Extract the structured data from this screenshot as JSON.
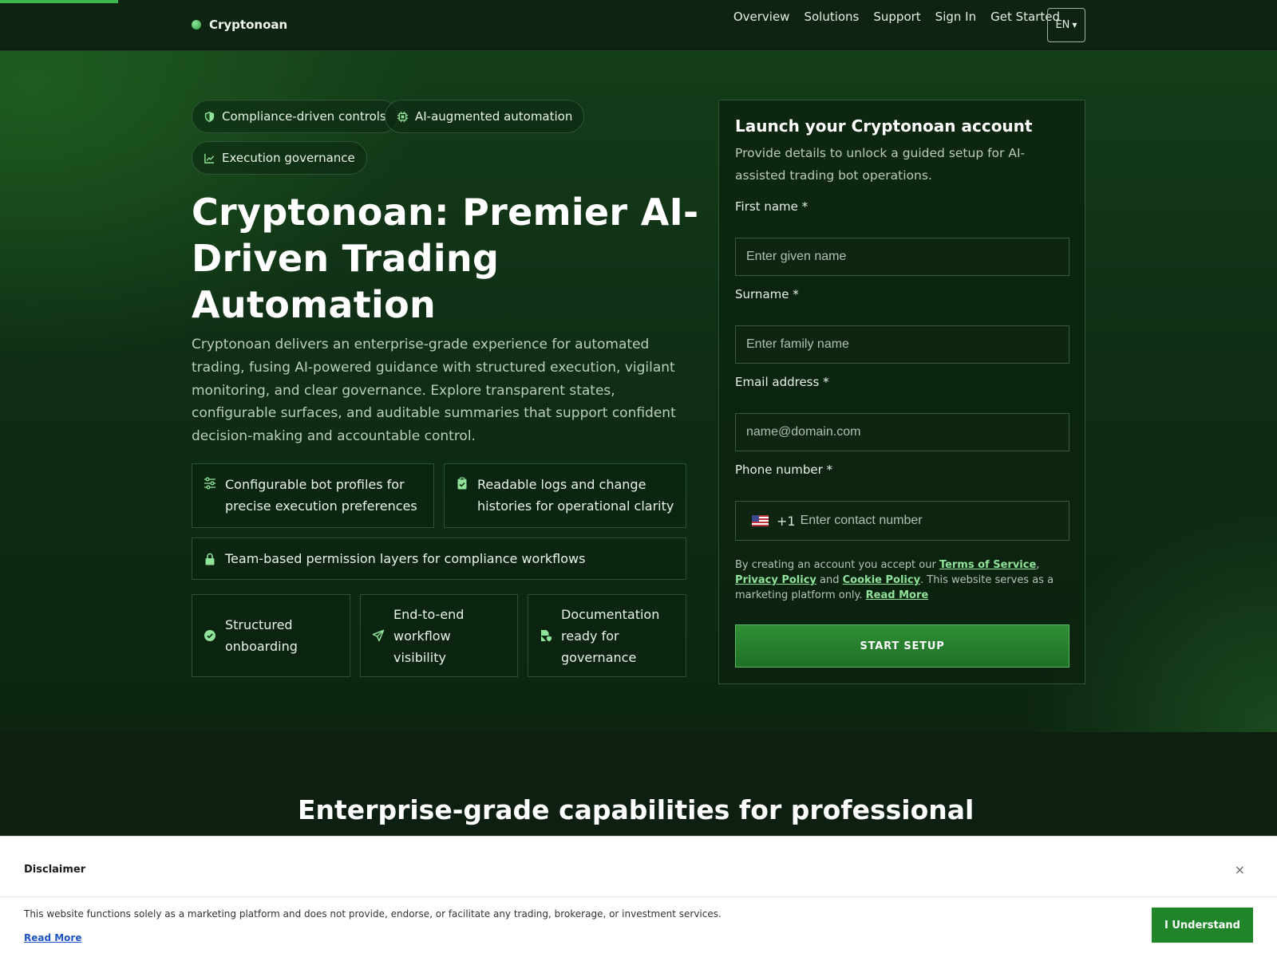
{
  "colors": {
    "accent": "#3fb54f",
    "button": "#1f8528",
    "background": "#0c1f10"
  },
  "header": {
    "brand": "Cryptonoan",
    "nav": [
      "Overview",
      "Solutions",
      "Support",
      "Sign In",
      "Get Started"
    ],
    "language": "EN"
  },
  "hero": {
    "pills": [
      {
        "label": "Compliance-driven controls",
        "icon": "shield-icon"
      },
      {
        "label": "AI-augmented automation",
        "icon": "chip-icon"
      },
      {
        "label": "Execution governance",
        "icon": "chart-line-icon"
      }
    ],
    "title": "Cryptonoan: Premier AI-Driven Trading Automation",
    "description": "Cryptonoan delivers an enterprise-grade experience for automated trading, fusing AI-powered guidance with structured execution, vigilant monitoring, and clear governance. Explore transparent states, configurable surfaces, and auditable summaries that support confident decision-making and accountable control.",
    "features": [
      {
        "label": "Configurable bot profiles for precise execution preferences",
        "icon": "sliders-icon"
      },
      {
        "label": "Readable logs and change histories for operational clarity",
        "icon": "clipboard-check-icon"
      },
      {
        "label": "Team-based permission layers for compliance workflows",
        "icon": "lock-icon"
      },
      {
        "label": "Structured onboarding",
        "icon": "check-circle-icon"
      },
      {
        "label": "End-to-end workflow visibility",
        "icon": "send-icon"
      },
      {
        "label": "Documentation ready for governance",
        "icon": "file-shield-icon"
      }
    ]
  },
  "form": {
    "title": "Launch your Cryptonoan account",
    "subtitle": "Provide details to unlock a guided setup for AI-assisted trading bot operations.",
    "first_name_label": "First name *",
    "first_name_placeholder": "Enter given name",
    "surname_label": "Surname *",
    "surname_placeholder": "Enter family name",
    "email_label": "Email address *",
    "email_placeholder": "name@domain.com",
    "phone_label": "Phone number *",
    "phone_dial_code": "+1",
    "phone_placeholder": "Enter contact number",
    "terms_prefix": "By creating an account you accept our ",
    "terms_link": "Terms of Service",
    "terms_comma": ", ",
    "privacy_link": "Privacy Policy",
    "terms_and": " and ",
    "cookie_link": "Cookie Policy",
    "terms_suffix": ". This website serves as a marketing platform only. ",
    "read_more": "Read More",
    "submit": "START SETUP"
  },
  "section": {
    "title_line1": "Enterprise-grade capabilities for professional",
    "title_line2": ""
  },
  "disclaimer": {
    "title": "Disclaimer",
    "close": "×",
    "text": "This website functions solely as a marketing platform and does not provide, endorse, or facilitate any trading, brokerage, or investment services.",
    "read_more": "Read More",
    "button": "I Understand"
  },
  "progress": {
    "fraction": 0.0925
  }
}
